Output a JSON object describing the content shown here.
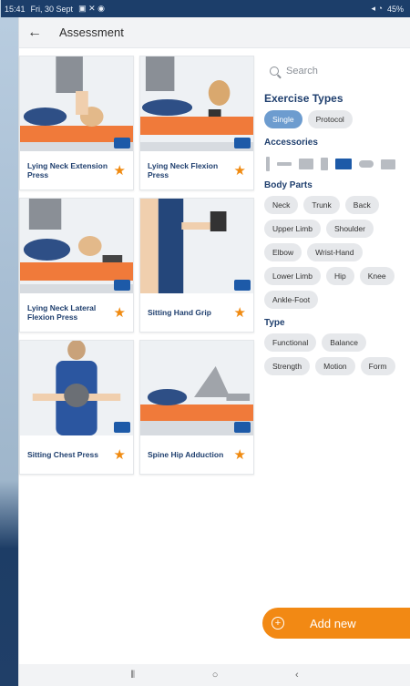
{
  "status_bar": {
    "time": "15:41",
    "date": "Fri, 30 Sept",
    "battery": "45%"
  },
  "app_bar": {
    "title": "Assessment"
  },
  "exercises": [
    {
      "title": "Lying Neck Extension Press",
      "favorite": true
    },
    {
      "title": "Lying Neck Flexion Press",
      "favorite": true
    },
    {
      "title": "Lying Neck Lateral Flexion Press",
      "favorite": true
    },
    {
      "title": "Sitting Hand Grip",
      "favorite": true
    },
    {
      "title": "Sitting Chest Press",
      "favorite": true
    },
    {
      "title": "Spine Hip Adduction",
      "favorite": true
    }
  ],
  "filters": {
    "search_placeholder": "Search",
    "exercise_types": {
      "title": "Exercise Types",
      "options": [
        "Single",
        "Protocol"
      ],
      "selected": "Single"
    },
    "accessories": {
      "title": "Accessories",
      "items": [
        "roller-icon",
        "bar-icon",
        "block-icon",
        "board-icon",
        "pad-icon",
        "band-icon",
        "mat-icon"
      ],
      "selected": "pad-icon"
    },
    "body_parts": {
      "title": "Body Parts",
      "options": [
        "Neck",
        "Trunk",
        "Back",
        "Upper Limb",
        "Shoulder",
        "Elbow",
        "Wrist-Hand",
        "Lower Limb",
        "Hip",
        "Knee",
        "Ankle-Foot"
      ]
    },
    "type": {
      "title": "Type",
      "options": [
        "Functional",
        "Balance",
        "Strength",
        "Motion",
        "Form"
      ]
    }
  },
  "add_button": {
    "label": "Add new"
  },
  "colors": {
    "accent": "#f28914",
    "brand": "#1f3f6e",
    "chip_active": "#6d9ccf"
  }
}
